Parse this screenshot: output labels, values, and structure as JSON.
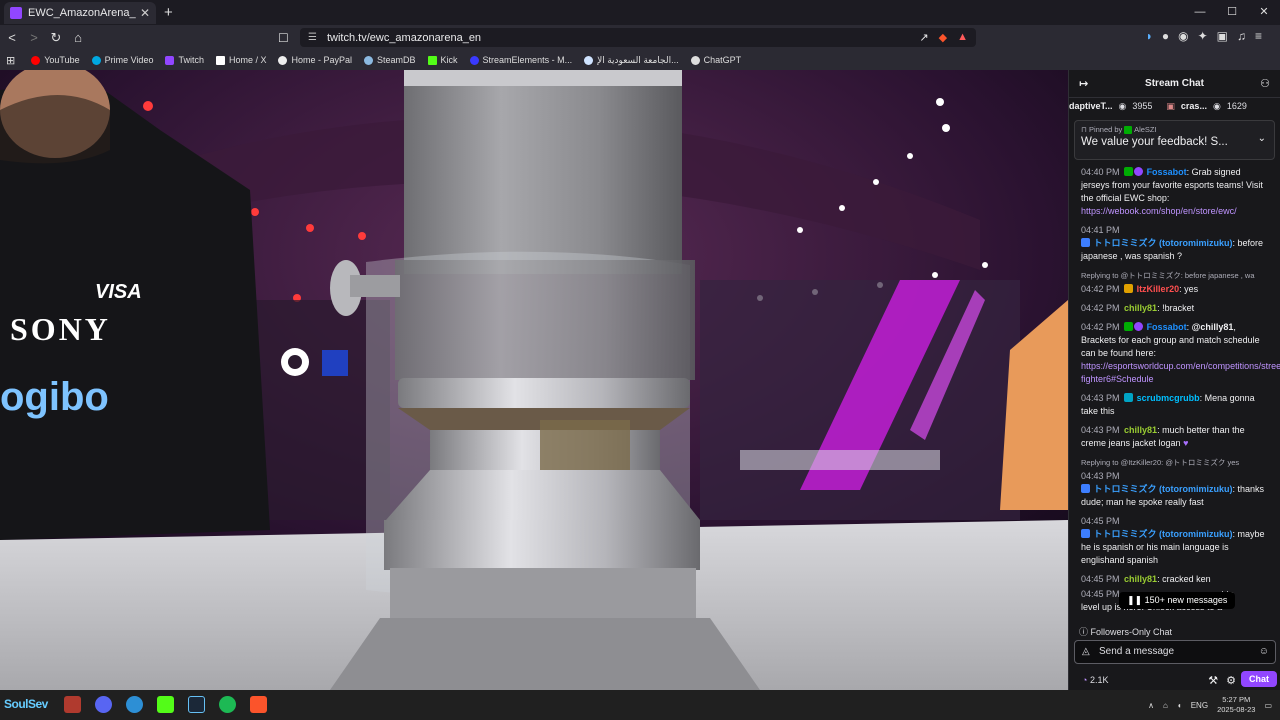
{
  "browser": {
    "tab_title": "EWC_AmazonArena_EN - Twitch",
    "url": "twitch.tv/ewc_amazonarena_en",
    "bookmarks": [
      {
        "label": "YouTube",
        "color": "#ff0000"
      },
      {
        "label": "Prime Video",
        "color": "#00a8e1"
      },
      {
        "label": "Twitch",
        "color": "#9146ff"
      },
      {
        "label": "Home / X",
        "color": "#ffffff"
      },
      {
        "label": "Home - PayPal",
        "color": "#ffffff"
      },
      {
        "label": "SteamDB",
        "color": "#8bb9e0"
      },
      {
        "label": "Kick",
        "color": "#53fc18"
      },
      {
        "label": "StreamElements - M...",
        "color": "#3a3aff"
      },
      {
        "label": "الجامعة السعودية الإ...",
        "color": "#cfe3ff"
      },
      {
        "label": "ChatGPT",
        "color": "#dddddd"
      }
    ]
  },
  "chat": {
    "header": "Stream Chat",
    "viewers": [
      {
        "name": "daptiveT...",
        "count": "3955"
      },
      {
        "name": "cras...",
        "count": "1629"
      }
    ],
    "pinned": {
      "by_prefix": "Pinned by",
      "by_user": "AleSZI",
      "message": "We value your feedback! S..."
    },
    "messages": [
      {
        "time": "04:40 PM",
        "user": "Fossabot",
        "text": ": Grab signed jerseys from your favorite esports teams! Visit the official EWC shop: ",
        "link": "https://webook.com/shop/en/store/ewc/"
      },
      {
        "time": "04:41 PM",
        "user": "トトロミミズク (totoromimizuku)",
        "text": ": before japanese , was spanish ?"
      },
      {
        "reply": "Replying to @トトロミミズク: before japanese , wa",
        "time": "04:42 PM",
        "user": "ItzKiller20",
        "text": ": yes"
      },
      {
        "time": "04:42 PM",
        "user": "chilly81",
        "text": ": !bracket"
      },
      {
        "time": "04:42 PM",
        "user": "Fossabot",
        "mention": "@chilly81",
        "text": ", Brackets for each group and match schedule can be found here: ",
        "link": "https://esportsworldcup.com/en/competitions/street-fighter6#Schedule"
      },
      {
        "time": "04:43 PM",
        "user": "scrubmcgrubb",
        "text": ": Mena gonna take this"
      },
      {
        "time": "04:43 PM",
        "user": "chilly81",
        "text": ": much better than the creme jeans jacket logan"
      },
      {
        "reply": "Replying to @ItzKiller20: @トトロミミズク yes",
        "time": "04:43 PM",
        "user": "トトロミミズク (totoromimizuku)",
        "text": ": thanks dude; man he spoke really fast"
      },
      {
        "time": "04:45 PM",
        "user": "トトロミミズク (totoromimizuku)",
        "text": ": maybe he is spanish or his main language is englishand spanish"
      },
      {
        "time": "04:45 PM",
        "user": "chilly81",
        "text": ": cracked ken"
      },
      {
        "time": "04:45 PM",
        "text_tail": "ment to",
        "text_line2": "level up is here. Unlock access to a"
      }
    ],
    "new_messages": "150+ new messages",
    "followers_only": "Followers-Only Chat",
    "input_placeholder": "Send a message",
    "points": "2.1K",
    "chat_button": "Chat"
  },
  "taskbar": {
    "overlay_text": "SoulSev",
    "lang": "ENG",
    "time": "5:27 PM",
    "date": "2025-08-23"
  }
}
